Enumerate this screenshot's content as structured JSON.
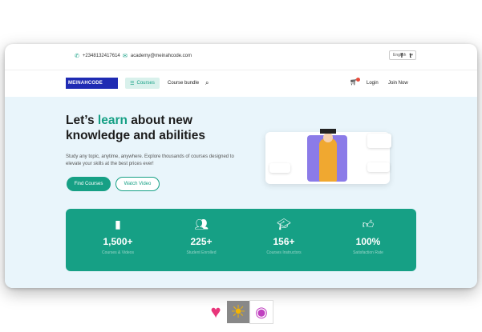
{
  "topbar": {
    "phone": "+2348132417614",
    "email": "academy@meinahcode.com",
    "language": "English"
  },
  "navbar": {
    "logo_text": "MEINAHCODE",
    "courses_label": "Courses",
    "course_bundle_label": "Course bundle",
    "login_label": "Login",
    "join_label": "Join Now"
  },
  "hero": {
    "headline_pre": "Let’s ",
    "headline_accent": "learn",
    "headline_post": " about new knowledge and abilities",
    "subtitle": "Study any topic, anytime, anywhere. Explore thousands of courses designed to elevate your skills at the best prices ever!",
    "find_courses": "Find Courses",
    "watch_video": "Watch Video"
  },
  "stats": [
    {
      "icon": "book-icon",
      "value": "1,500+",
      "label": "Courses & Videos"
    },
    {
      "icon": "users-icon",
      "value": "225+",
      "label": "Student Enrolled"
    },
    {
      "icon": "graduation-cap-icon",
      "value": "156+",
      "label": "Courses Instructors"
    },
    {
      "icon": "thumbs-up-icon",
      "value": "100%",
      "label": "Satisfaction Rate"
    }
  ],
  "colors": {
    "accent": "#16a085",
    "brand": "#1f2bb3",
    "hero_bg": "#e9f5fb"
  }
}
